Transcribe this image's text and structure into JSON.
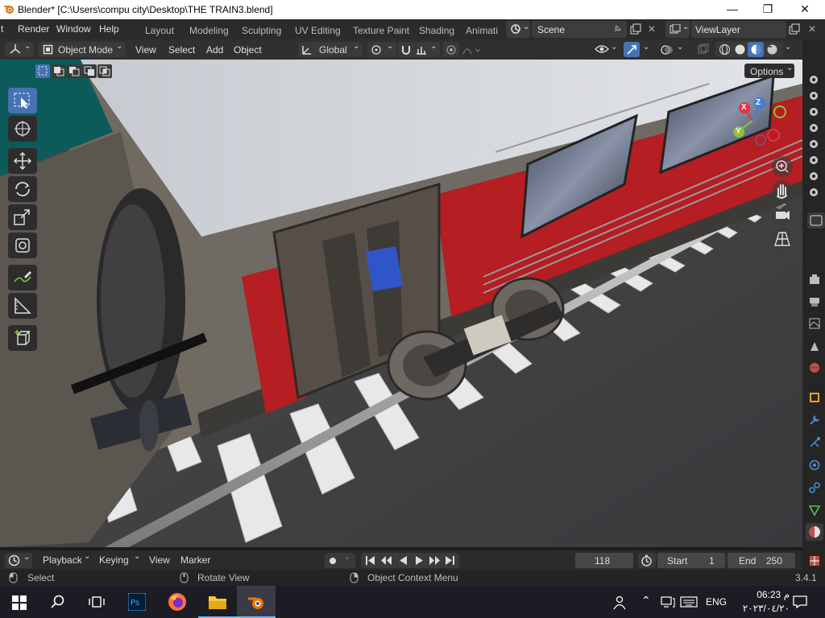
{
  "window": {
    "title": "Blender* [C:\\Users\\compu city\\Desktop\\THE TRAIN3.blend]",
    "minimize": "—",
    "maximize": "❐",
    "close": "✕"
  },
  "menu": {
    "items": [
      "t",
      "Render",
      "Window",
      "Help"
    ]
  },
  "workspaces": [
    "Layout",
    "Modeling",
    "Sculpting",
    "UV Editing",
    "Texture Paint",
    "Shading",
    "Animati"
  ],
  "scene": {
    "name": "Scene"
  },
  "viewlayer": {
    "name": "ViewLayer"
  },
  "header": {
    "mode": "Object Mode",
    "view": "View",
    "select": "Select",
    "add": "Add",
    "object": "Object",
    "orientation": "Global"
  },
  "viewport": {
    "options": "Options",
    "gizmo": {
      "x": "X",
      "y": "Y",
      "z": "Z"
    }
  },
  "timeline": {
    "playback": "Playback",
    "keying": "Keying",
    "view": "View",
    "marker": "Marker",
    "current_frame": "118",
    "start_label": "Start",
    "start_value": "1",
    "end_label": "End",
    "end_value": "250"
  },
  "statusbar": {
    "select": "Select",
    "rotate": "Rotate View",
    "context": "Object Context Menu",
    "version": "3.4.1"
  },
  "taskbar": {
    "lang": "ENG",
    "time": "06:23 م",
    "date": "٢٠٢٣/٠٤/٢٠"
  },
  "colors": {
    "accent": "#4772b3",
    "train_red": "#b51e22",
    "gizmo_x": "#e2334a",
    "gizmo_y": "#8bc33a",
    "gizmo_z": "#3f7fd8"
  }
}
